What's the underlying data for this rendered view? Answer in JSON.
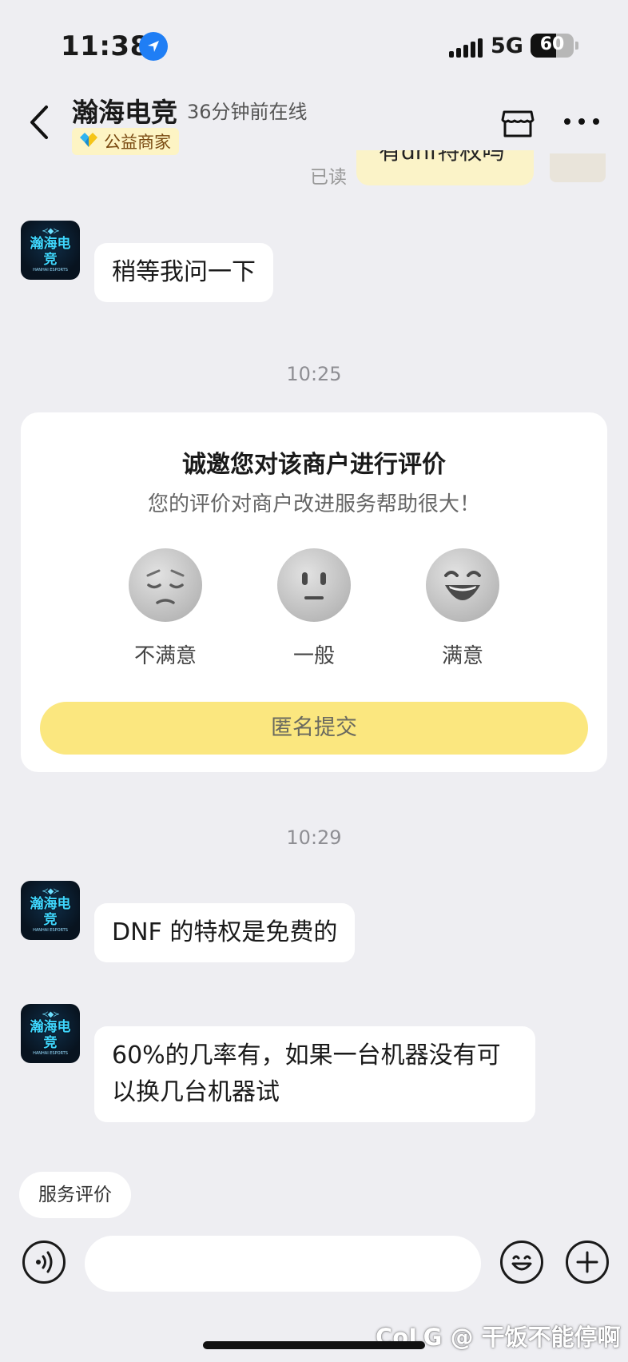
{
  "status_bar": {
    "time": "11:38",
    "network": "5G",
    "battery": "60"
  },
  "header": {
    "title": "瀚海电竞",
    "online_status": "36分钟前在线",
    "badge_label": "公益商家"
  },
  "previous_message": {
    "read_status": "已读",
    "text": "有dnf特权吗"
  },
  "avatar": {
    "text": "瀚海电竞",
    "sub": "HANHAI ESPORTS"
  },
  "messages": [
    {
      "text": "稍等我问一下"
    },
    {
      "time": "10:25"
    },
    {
      "time": "10:29"
    },
    {
      "text": "DNF 的特权是免费的"
    },
    {
      "text": "60%的几率有，如果一台机器没有可以换几台机器试"
    }
  ],
  "review_card": {
    "title": "诚邀您对该商户进行评价",
    "subtitle": "您的评价对商户改进服务帮助很大！",
    "options": [
      {
        "label": "不满意",
        "icon": "sad-face-icon"
      },
      {
        "label": "一般",
        "icon": "neutral-face-icon"
      },
      {
        "label": "满意",
        "icon": "happy-face-icon"
      }
    ],
    "submit_label": "匿名提交"
  },
  "quick_reply": {
    "label": "服务评价"
  },
  "input": {
    "placeholder": ""
  },
  "watermark": "CoLG @ 干饭不能停啊",
  "colors": {
    "background": "#eeeef2",
    "submit_button": "#fbe77f",
    "badge_bg": "#fdf4c4",
    "location_blue": "#1f7ef5"
  }
}
